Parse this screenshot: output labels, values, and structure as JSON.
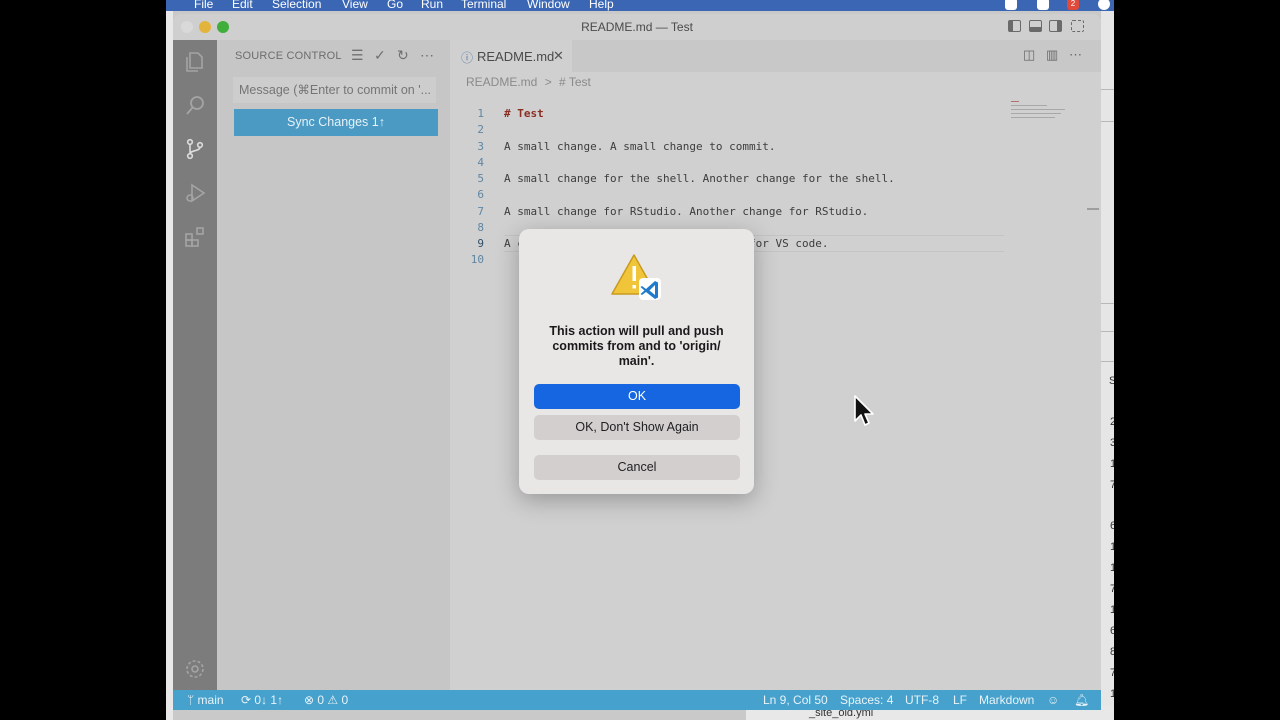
{
  "menubar": {
    "items": [
      "File",
      "Edit",
      "Selection",
      "View",
      "Go",
      "Run",
      "Terminal",
      "Window",
      "Help"
    ],
    "badge": "2"
  },
  "window": {
    "title": "README.md — Test"
  },
  "sidebar": {
    "title": "SOURCE CONTROL",
    "commit_placeholder": "Message (⌘Enter to commit on '...",
    "sync_button_label": "Sync Changes 1↑"
  },
  "editor": {
    "tab_label": "README.md",
    "breadcrumb": [
      "README.md",
      ">",
      "# Test"
    ],
    "lines": [
      {
        "no": "1",
        "text": "# Test"
      },
      {
        "no": "2",
        "text": ""
      },
      {
        "no": "3",
        "text": "A small change. A small change to commit."
      },
      {
        "no": "4",
        "text": ""
      },
      {
        "no": "5",
        "text": "A small change for the shell. Another change for the shell."
      },
      {
        "no": "6",
        "text": ""
      },
      {
        "no": "7",
        "text": "A small change for RStudio. Another change for RStudio."
      },
      {
        "no": "8",
        "text": ""
      },
      {
        "no": "9",
        "text": "A change for VS code. Another change for VS code."
      },
      {
        "no": "10",
        "text": ""
      }
    ]
  },
  "statusbar": {
    "branch": "main",
    "sync": "0↓ 1↑",
    "errors": "0",
    "warnings": "0",
    "position": "Ln 9, Col 50",
    "spaces": "Spaces: 4",
    "encoding": "UTF-8",
    "eol": "LF",
    "language": "Markdown"
  },
  "dialog": {
    "message": "This action will pull and push commits from and to 'origin/ main'.",
    "ok_label": "OK",
    "dont_show_label": "OK, Don't Show Again",
    "cancel_label": "Cancel"
  },
  "background": {
    "right_numbers": [
      "2",
      "3",
      "1",
      "7",
      "6",
      "1",
      "1",
      "7",
      "1",
      "6",
      "8",
      "7",
      "1"
    ],
    "right_letter": "S",
    "bottom_file": "_site_old.yml"
  },
  "colors": {
    "ok_button": "#1566e0",
    "statusbar": "#46a1cc",
    "sync_button": "#4b9ac4"
  }
}
